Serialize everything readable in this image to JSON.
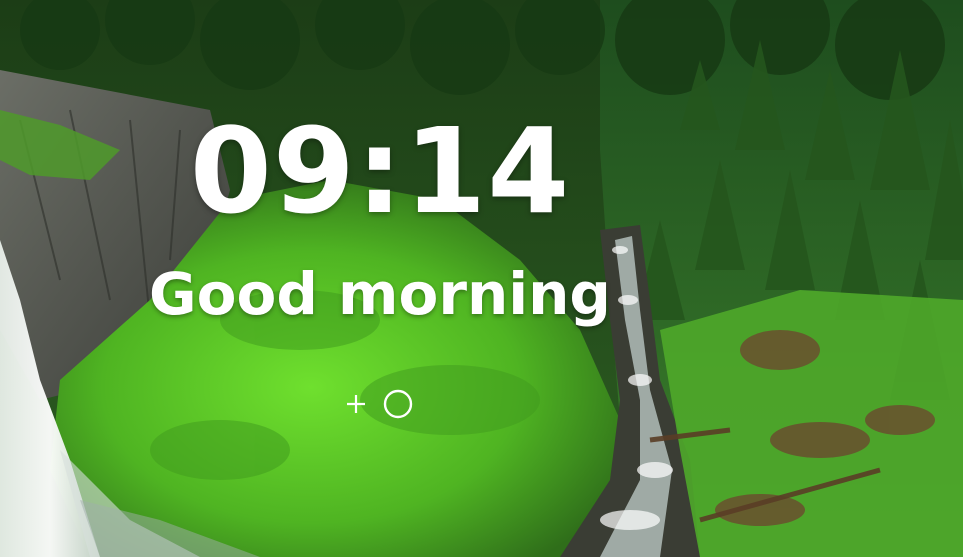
{
  "clock": {
    "time": "09:14"
  },
  "greeting": {
    "text": "Good morning"
  },
  "actions": [
    {
      "icon": "plus-icon"
    },
    {
      "icon": "circle-icon"
    }
  ],
  "colors": {
    "text": "#ffffff",
    "forest_dark": "#1f4a1c",
    "moss_green": "#5fcf2a",
    "cliff_gray": "#5a5d55"
  }
}
